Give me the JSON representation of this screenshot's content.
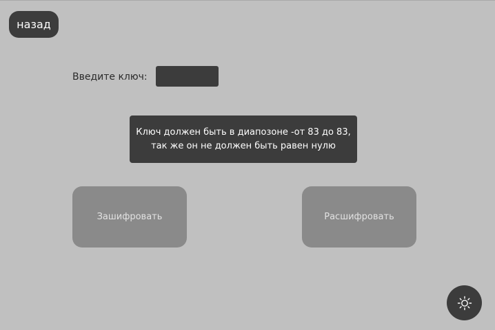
{
  "back_button": {
    "label": "назад"
  },
  "key": {
    "label": "Введите ключ:",
    "value": "",
    "placeholder": ""
  },
  "hint": {
    "text": "Ключ должен быть в диапозоне -от 83 до 83, так же он не должен быть равен нулю"
  },
  "actions": {
    "encrypt_label": "Зашифровать",
    "decrypt_label": "Расшифровать"
  },
  "theme_toggle": {
    "icon": "sun-icon"
  },
  "colors": {
    "background": "#c0c0c0",
    "dark_surface": "#3c3c3c",
    "disabled_button": "#8a8a8a",
    "disabled_text": "#e2e2e2"
  }
}
